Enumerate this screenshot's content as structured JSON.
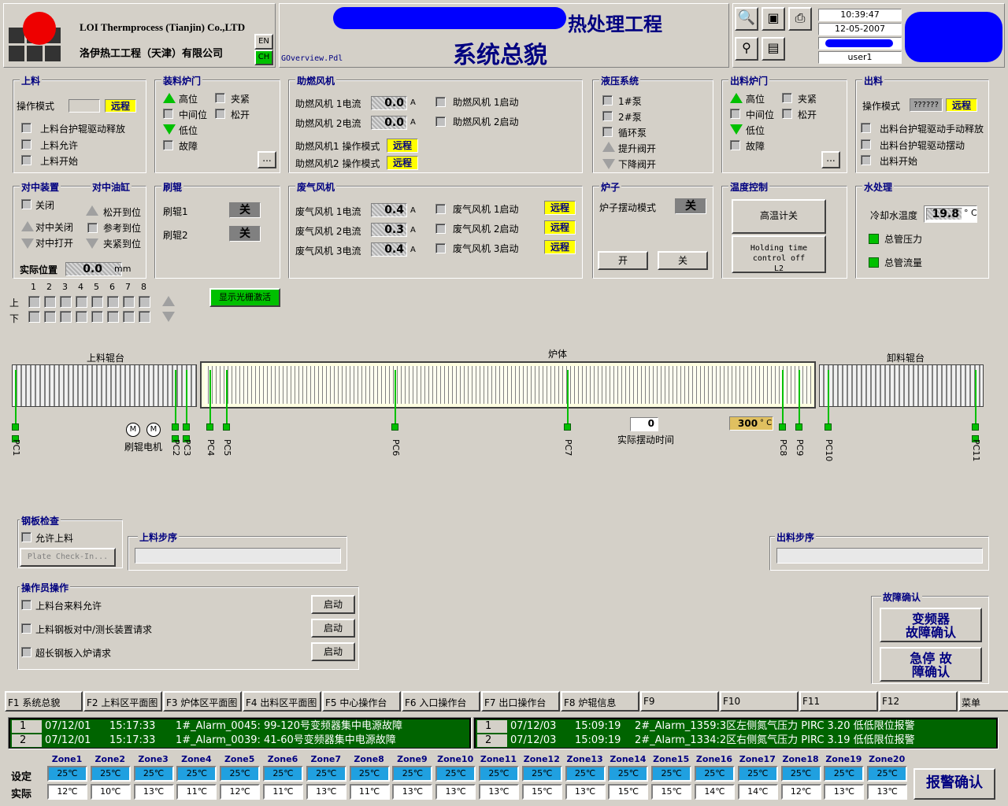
{
  "header": {
    "company_en": "LOI Thermprocess (Tianjin) Co.,LTD",
    "company_cn": "洛伊热工工程（天津）有限公司",
    "lang_en": "EN",
    "lang_cn": "CH",
    "app_title": "热处理工程",
    "page_title": "系统总貌",
    "file_name": "GOverview.Pdl",
    "time": "10:39:47",
    "date": "12-05-2007",
    "user": "user1"
  },
  "loading": {
    "title": "上料",
    "mode_label": "操作模式",
    "mode_value": "远程",
    "items": [
      "上料台护辊驱动释放",
      "上料允许",
      "上料开始"
    ]
  },
  "charging_door": {
    "title": "装料炉门",
    "high": "高位",
    "mid": "中间位",
    "low": "低位",
    "fault": "故障",
    "clamp": "夹紧",
    "release": "松开",
    "more": "..."
  },
  "combustion_fan": {
    "title": "助燃风机",
    "rows": [
      {
        "label": "助燃风机 1电流",
        "value": "0.0",
        "unit": "A",
        "start": "助燃风机 1启动"
      },
      {
        "label": "助燃风机 2电流",
        "value": "0.0",
        "unit": "A",
        "start": "助燃风机 2启动"
      }
    ],
    "mode1": "助燃风机1 操作模式",
    "mode2": "助燃风机2 操作模式",
    "mode_value": "远程"
  },
  "hydraulic": {
    "title": "液压系统",
    "items": [
      "1#泵",
      "2#泵",
      "循环泵"
    ],
    "valve_up": "提升阀开",
    "valve_down": "下降阀开"
  },
  "discharge_door": {
    "title": "出料炉门",
    "high": "高位",
    "mid": "中间位",
    "low": "低位",
    "fault": "故障",
    "clamp": "夹紧",
    "release": "松开",
    "more": "..."
  },
  "discharge": {
    "title": "出料",
    "mode_label": "操作模式",
    "mode_box": "??????",
    "mode_value": "远程",
    "items": [
      "出料台护辊驱动手动释放",
      "出料台护辊驱动摆动",
      "出料开始"
    ]
  },
  "centering": {
    "title": "对中装置",
    "title2": "对中油缸",
    "close": "关闭",
    "center_close": "对中关闭",
    "center_open": "对中打开",
    "release_pos": "松开到位",
    "ref_pos": "参考到位",
    "clamp_pos": "夹紧到位",
    "actual_label": "实际位置",
    "actual_value": "0.0",
    "actual_unit": "mm"
  },
  "brush": {
    "title": "刷辊",
    "brush1": "刷辊1",
    "brush2": "刷辊2",
    "off": "关"
  },
  "exhaust_fan": {
    "title": "废气风机",
    "rows": [
      {
        "label": "废气风机 1电流",
        "value": "0.4",
        "unit": "A",
        "start": "废气风机 1启动",
        "mode": "远程"
      },
      {
        "label": "废气风机 2电流",
        "value": "0.3",
        "unit": "A",
        "start": "废气风机 2启动",
        "mode": "远程"
      },
      {
        "label": "废气风机 3电流",
        "value": "0.4",
        "unit": "A",
        "start": "废气风机 3启动",
        "mode": "远程"
      }
    ]
  },
  "furnace": {
    "title": "炉子",
    "swing_label": "炉子摆动模式",
    "swing_value": "关",
    "open": "开",
    "close": "关"
  },
  "temp_control": {
    "title": "温度控制",
    "high_temp": "高温计关",
    "holding": "Holding time control off L2"
  },
  "water": {
    "title": "水处理",
    "cool_label": "冷却水温度",
    "cool_value": "19.8",
    "cool_unit": "° C",
    "pressure": "总管压力",
    "flow": "总管流量"
  },
  "grid": {
    "cols": [
      "1",
      "2",
      "3",
      "4",
      "5",
      "6",
      "7",
      "8"
    ],
    "upper": "上",
    "lower": "下",
    "light_btn": "显示光栅激活"
  },
  "line": {
    "loading_table": "上料辊台",
    "furnace_body": "炉体",
    "unloading_table": "卸料辊台",
    "motor_m": "M",
    "brush_motor": "刷辊电机",
    "swing_time_value": "0",
    "swing_time_label": "实际摆动时间",
    "temp_value": "300",
    "temp_unit": "° C",
    "pcs": [
      "PC1",
      "PC2",
      "PC3",
      "PC4",
      "PC5",
      "PC6",
      "PC7",
      "PC8",
      "PC9",
      "PC10",
      "PC11"
    ]
  },
  "plate_check": {
    "title": "钢板检查",
    "allow": "允许上料",
    "btn": "Plate Check-In..."
  },
  "load_step": {
    "title": "上料步序"
  },
  "unload_step": {
    "title": "出料步序"
  },
  "operator": {
    "title": "操作员操作",
    "items": [
      {
        "label": "上料台来料允许",
        "btn": "启动"
      },
      {
        "label": "上料钢板对中/测长装置请求",
        "btn": "启动"
      },
      {
        "label": "超长钢板入炉请求",
        "btn": "启动"
      }
    ]
  },
  "fault_ack": {
    "title": "故障确认",
    "vfd": "变频器 故障确认",
    "estop": "急停 故障确认"
  },
  "fkeys": [
    "F1 系统总貌",
    "F2 上料区平面图",
    "F3 炉体区平面图",
    "F4 出料区平面图",
    "F5 中心操作台",
    "F6 入口操作台",
    "F7 出口操作台",
    "F8 炉辊信息",
    "F9",
    "F10",
    "F11",
    "F12",
    "菜单"
  ],
  "alarms_left": [
    {
      "no": "1",
      "date": "07/12/01",
      "time": "15:17:33",
      "msg": "1#_Alarm_0045: 99-120号变频器集中电源故障"
    },
    {
      "no": "2",
      "date": "07/12/01",
      "time": "15:17:33",
      "msg": "1#_Alarm_0039: 41-60号变频器集中电源故障"
    }
  ],
  "alarms_right": [
    {
      "no": "1",
      "date": "07/12/03",
      "time": "15:09:19",
      "msg": "2#_Alarm_1359:3区左侧氮气压力 PIRC 3.20 低低限位报警"
    },
    {
      "no": "2",
      "date": "07/12/03",
      "time": "15:09:19",
      "msg": "2#_Alarm_1334:2区右侧氮气压力 PIRC 3.19 低低限位报警"
    }
  ],
  "zones": {
    "set_label": "设定",
    "act_label": "实际",
    "unit": "℃",
    "names": [
      "Zone1",
      "Zone2",
      "Zone3",
      "Zone4",
      "Zone5",
      "Zone6",
      "Zone7",
      "Zone8",
      "Zone9",
      "Zone10",
      "Zone11",
      "Zone12",
      "Zone13",
      "Zone14",
      "Zone15",
      "Zone16",
      "Zone17",
      "Zone18",
      "Zone19",
      "Zone20"
    ],
    "set": [
      "25",
      "25",
      "25",
      "25",
      "25",
      "25",
      "25",
      "25",
      "25",
      "25",
      "25",
      "25",
      "25",
      "25",
      "25",
      "25",
      "25",
      "25",
      "25",
      "25"
    ],
    "act": [
      "12",
      "10",
      "13",
      "11",
      "12",
      "11",
      "13",
      "11",
      "13",
      "13",
      "13",
      "15",
      "13",
      "15",
      "15",
      "14",
      "14",
      "12",
      "13",
      "13"
    ],
    "alarm_ack": "报警确认"
  },
  "colors": {
    "accent": "#000080",
    "ok": "#00c000",
    "remote": "#ffff00",
    "alarm_bg": "#006400"
  }
}
